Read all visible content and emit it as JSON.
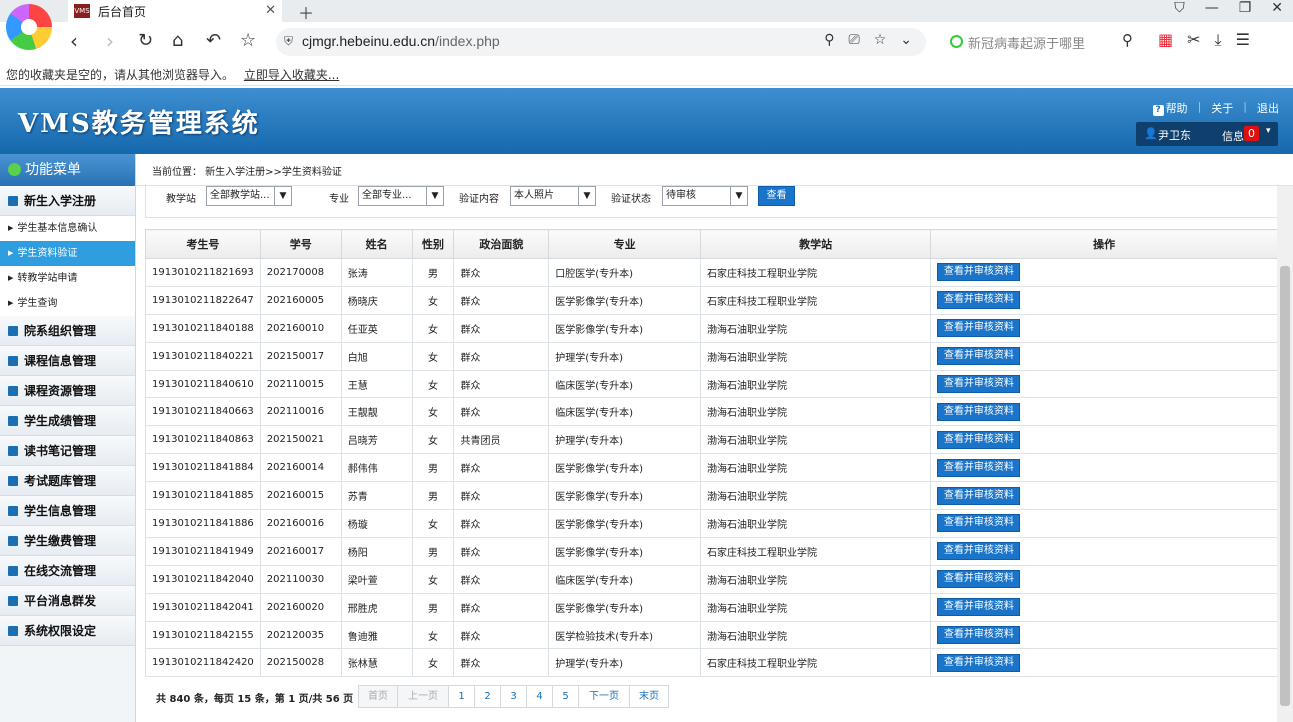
{
  "browser": {
    "tab_title": "后台首页",
    "tab_favicon_text": "VMS",
    "url_domain": "cjmgr.hebeinu.edu.cn",
    "url_path": "/index.php",
    "search_placeholder": "新冠病毒起源于哪里",
    "bookmark_notice": "您的收藏夹是空的，请从其他浏览器导入。",
    "bookmark_import_link": "立即导入收藏夹..."
  },
  "header": {
    "logo": "VMS教务管理系统",
    "help": "帮助",
    "about": "关于",
    "logout": "退出",
    "user_name": "尹卫东",
    "info_label": "信息",
    "info_count": "0"
  },
  "sidebar": {
    "title": "功能菜单",
    "items": [
      {
        "label": "新生入学注册"
      },
      {
        "label": "院系组织管理"
      },
      {
        "label": "课程信息管理"
      },
      {
        "label": "课程资源管理"
      },
      {
        "label": "学生成绩管理"
      },
      {
        "label": "读书笔记管理"
      },
      {
        "label": "考试题库管理"
      },
      {
        "label": "学生信息管理"
      },
      {
        "label": "学生缴费管理"
      },
      {
        "label": "在线交流管理"
      },
      {
        "label": "平台消息群发"
      },
      {
        "label": "系统权限设定"
      }
    ],
    "sub_items": [
      {
        "label": "学生基本信息确认"
      },
      {
        "label": "学生资料验证"
      },
      {
        "label": "转教学站申请"
      },
      {
        "label": "学生查询"
      }
    ]
  },
  "breadcrumb": "当前位置： 新生入学注册>>学生资料验证",
  "filters": {
    "station_label": "教学站",
    "station_value": "全部教学站...",
    "major_label": "专业",
    "major_value": "全部专业...",
    "content_label": "验证内容",
    "content_value": "本人照片",
    "status_label": "验证状态",
    "status_value": "待审核",
    "query_button": "查看"
  },
  "table": {
    "headers": [
      "考生号",
      "学号",
      "姓名",
      "性别",
      "政治面貌",
      "专业",
      "教学站",
      "操作"
    ],
    "action_label": "查看并审核资料",
    "rows": [
      [
        "1913010211821693",
        "202170008",
        "张涛",
        "男",
        "群众",
        "口腔医学(专升本)",
        "石家庄科技工程职业学院"
      ],
      [
        "1913010211822647",
        "202160005",
        "杨晓庆",
        "女",
        "群众",
        "医学影像学(专升本)",
        "石家庄科技工程职业学院"
      ],
      [
        "1913010211840188",
        "202160010",
        "任亚英",
        "女",
        "群众",
        "医学影像学(专升本)",
        "渤海石油职业学院"
      ],
      [
        "1913010211840221",
        "202150017",
        "白旭",
        "女",
        "群众",
        "护理学(专升本)",
        "渤海石油职业学院"
      ],
      [
        "1913010211840610",
        "202110015",
        "王慧",
        "女",
        "群众",
        "临床医学(专升本)",
        "渤海石油职业学院"
      ],
      [
        "1913010211840663",
        "202110016",
        "王靓靓",
        "女",
        "群众",
        "临床医学(专升本)",
        "渤海石油职业学院"
      ],
      [
        "1913010211840863",
        "202150021",
        "吕晓芳",
        "女",
        "共青团员",
        "护理学(专升本)",
        "渤海石油职业学院"
      ],
      [
        "1913010211841884",
        "202160014",
        "郝伟伟",
        "男",
        "群众",
        "医学影像学(专升本)",
        "渤海石油职业学院"
      ],
      [
        "1913010211841885",
        "202160015",
        "苏青",
        "男",
        "群众",
        "医学影像学(专升本)",
        "渤海石油职业学院"
      ],
      [
        "1913010211841886",
        "202160016",
        "杨璇",
        "女",
        "群众",
        "医学影像学(专升本)",
        "渤海石油职业学院"
      ],
      [
        "1913010211841949",
        "202160017",
        "杨阳",
        "男",
        "群众",
        "医学影像学(专升本)",
        "石家庄科技工程职业学院"
      ],
      [
        "1913010211842040",
        "202110030",
        "梁叶萱",
        "女",
        "群众",
        "临床医学(专升本)",
        "渤海石油职业学院"
      ],
      [
        "1913010211842041",
        "202160020",
        "邢胜虎",
        "男",
        "群众",
        "医学影像学(专升本)",
        "渤海石油职业学院"
      ],
      [
        "1913010211842155",
        "202120035",
        "鲁迪雅",
        "女",
        "群众",
        "医学检验技术(专升本)",
        "渤海石油职业学院"
      ],
      [
        "1913010211842420",
        "202150028",
        "张林慧",
        "女",
        "群众",
        "护理学(专升本)",
        "石家庄科技工程职业学院"
      ]
    ]
  },
  "pager": {
    "summary": "共 840 条，每页 15 条，第 1 页/共 56 页",
    "first": "首页",
    "prev": "上一页",
    "pages": [
      "1",
      "2",
      "3",
      "4",
      "5"
    ],
    "next": "下一页",
    "last": "末页"
  },
  "colors": {
    "header_blue": "#1668ad",
    "button_blue": "#1a74c9",
    "active_sub": "#2f9ee0",
    "badge_red": "#e01010"
  }
}
